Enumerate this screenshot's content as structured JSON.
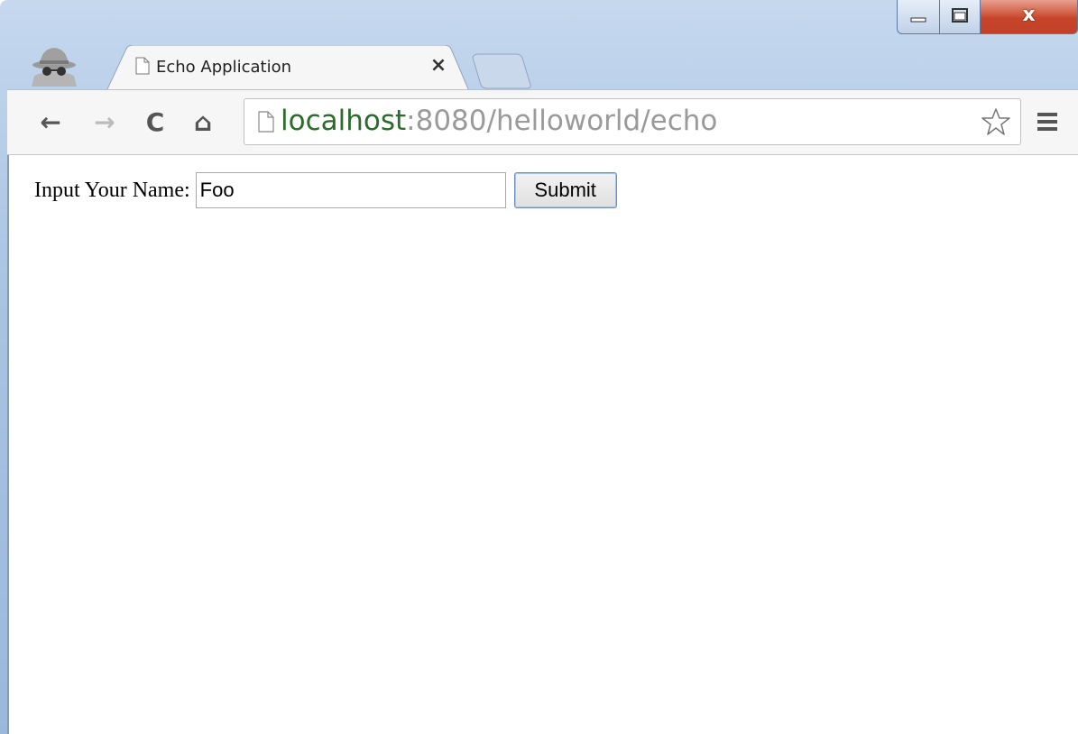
{
  "browser": {
    "tab": {
      "title": "Echo Application",
      "close_glyph": "×",
      "favicon_icon": "page-icon"
    },
    "incognito_icon": "incognito-icon",
    "window_controls": {
      "minimize_icon": "minimize-icon",
      "maximize_icon": "maximize-icon",
      "close_glyph": "x"
    },
    "toolbar": {
      "back_glyph": "←",
      "forward_glyph": "→",
      "reload_glyph": "C",
      "home_glyph": "⌂",
      "url_host": "localhost",
      "url_rest": ":8080/helloworld/echo",
      "star_icon": "star-icon",
      "menu_icon": "menu-icon"
    }
  },
  "page": {
    "label": "Input Your Name:",
    "name_value": "Foo",
    "submit_label": "Submit"
  }
}
